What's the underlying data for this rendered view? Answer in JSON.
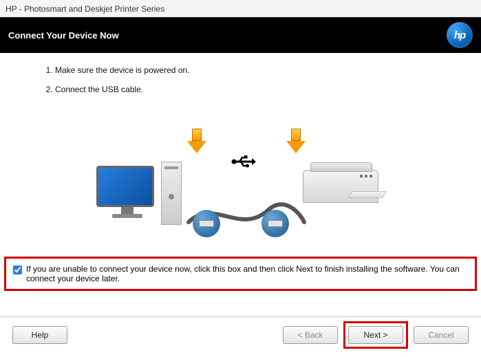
{
  "window_title": "HP - Photosmart and Deskjet Printer Series",
  "header": {
    "title": "Connect Your Device Now",
    "logo_text": "hp"
  },
  "steps": [
    "Make sure the device is powered on.",
    "Connect the USB cable."
  ],
  "checkbox": {
    "checked": true,
    "label": "If you are unable to connect your device now, click this box and then click Next to finish installing the software. You can connect your device later."
  },
  "buttons": {
    "help": "Help",
    "back": "< Back",
    "next": "Next >",
    "cancel": "Cancel"
  }
}
